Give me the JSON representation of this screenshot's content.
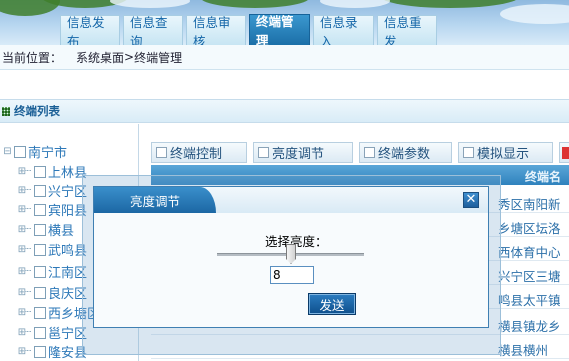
{
  "nav": {
    "tabs": [
      "信息发布",
      "信息查询",
      "信息审核",
      "终端管理",
      "信息录入",
      "信息重发"
    ],
    "active_index": 3
  },
  "breadcrumb": {
    "prefix": "当前位置：",
    "home": "系统桌面",
    "sep": " > ",
    "current": "终端管理"
  },
  "panel": {
    "title": "终端列表"
  },
  "tree": {
    "root": "南宁市",
    "children": [
      "上林县",
      "兴宁区",
      "宾阳县",
      "横县",
      "武鸣县",
      "江南区",
      "良庆区",
      "西乡塘区",
      "邕宁区",
      "隆安县"
    ]
  },
  "toolbar": {
    "buttons": [
      "终端控制",
      "亮度调节",
      "终端参数",
      "模拟显示"
    ]
  },
  "grid": {
    "last_header": "终端名"
  },
  "rows": [
    "秀区南阳新",
    "乡塘区坛洛",
    "西体育中心",
    "兴宁区三塘",
    "鸣县太平镇",
    "横县镇龙乡",
    "横县横州"
  ],
  "dialog": {
    "title": "亮度调节",
    "label": "选择亮度：",
    "value": "8",
    "submit": "发送",
    "close": "✕"
  }
}
